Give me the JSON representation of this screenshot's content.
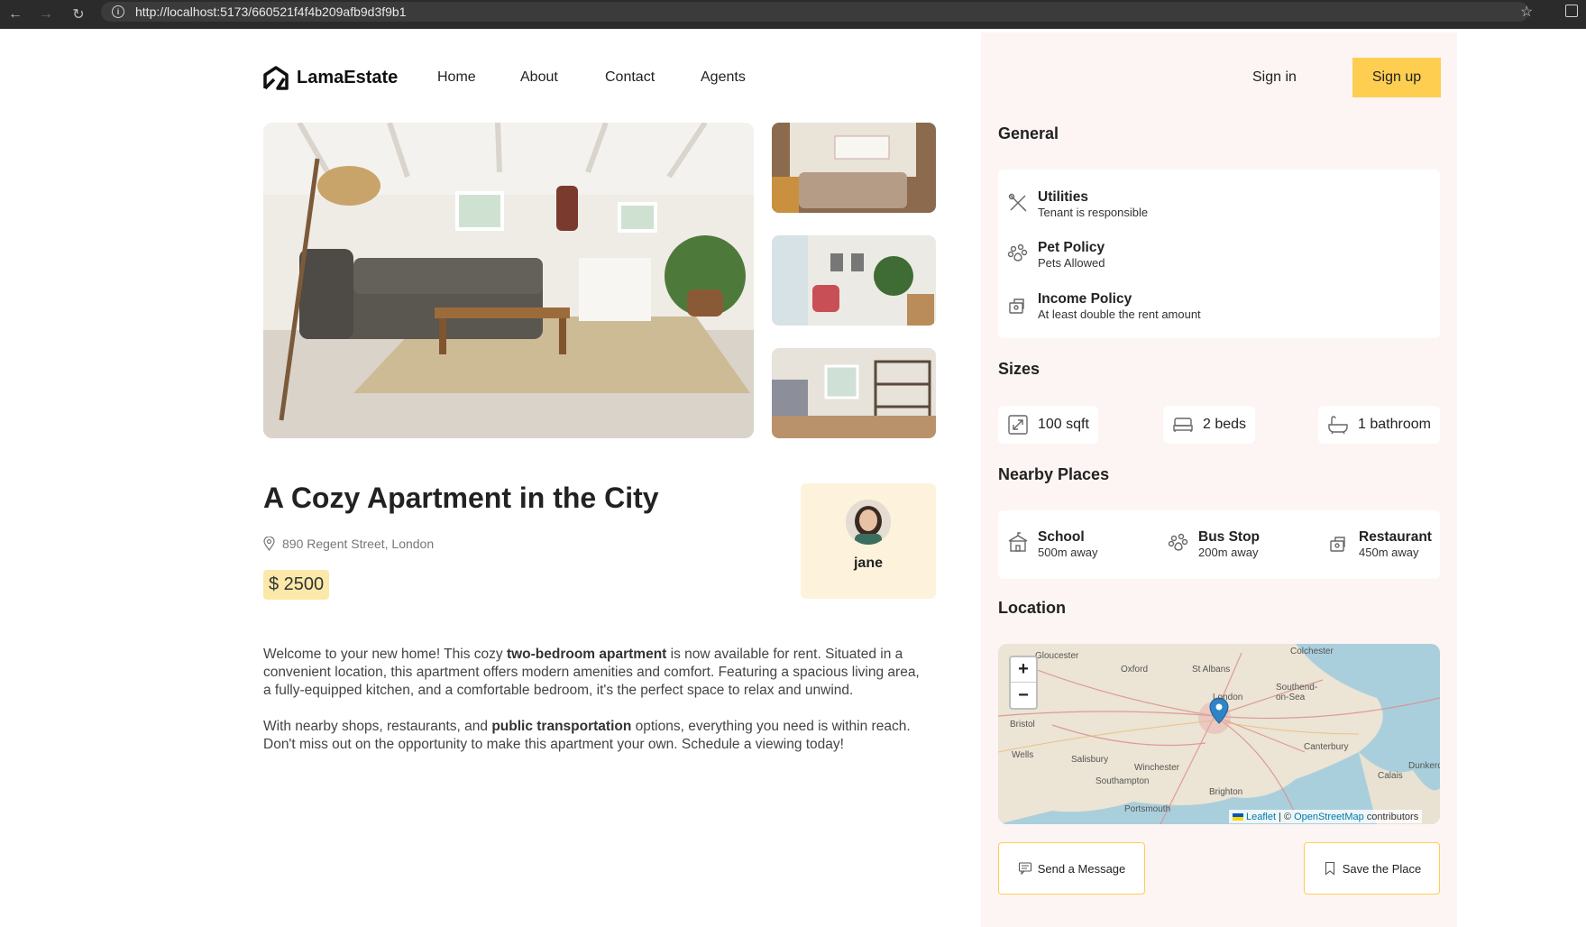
{
  "browser": {
    "url": "http://localhost:5173/660521f4f4b209afb9d3f9b1"
  },
  "navbar": {
    "brand": "LamaEstate",
    "links": [
      "Home",
      "About",
      "Contact",
      "Agents"
    ],
    "signin": "Sign in",
    "signup": "Sign up"
  },
  "listing": {
    "title": "A Cozy Apartment in the City",
    "address": "890 Regent Street, London",
    "price": "$ 2500",
    "user": "jane",
    "description_p1": {
      "t1": "Welcome to your new home! This cozy ",
      "b1": "two-bedroom apartment",
      "t2": " is now available for rent. Situated in a convenient location, this apartment offers modern amenities and comfort. Featuring a spacious living area, a fully-equipped kitchen, and a comfortable bedroom, it's the perfect space to relax and unwind."
    },
    "description_p2": {
      "t1": "With nearby shops, restaurants, and ",
      "b1": "public transportation",
      "t2": " options, everything you need is within reach. Don't miss out on the opportunity to make this apartment your own. Schedule a viewing today!"
    }
  },
  "general": {
    "title": "General",
    "items": [
      {
        "title": "Utilities",
        "sub": "Tenant is responsible",
        "icon": "utility-icon"
      },
      {
        "title": "Pet Policy",
        "sub": "Pets Allowed",
        "icon": "pet-icon"
      },
      {
        "title": "Income Policy",
        "sub": "At least double the rent amount",
        "icon": "fee-icon"
      }
    ]
  },
  "sizes": {
    "title": "Sizes",
    "items": [
      {
        "label": "100 sqft",
        "icon": "size-icon"
      },
      {
        "label": "2 beds",
        "icon": "bed-icon"
      },
      {
        "label": "1 bathroom",
        "icon": "bath-icon"
      }
    ]
  },
  "nearby": {
    "title": "Nearby Places",
    "items": [
      {
        "title": "School",
        "sub": "500m away",
        "icon": "school-icon"
      },
      {
        "title": "Bus Stop",
        "sub": "200m away",
        "icon": "bus-icon"
      },
      {
        "title": "Restaurant",
        "sub": "450m away",
        "icon": "restaurant-icon"
      }
    ]
  },
  "location": {
    "title": "Location",
    "zoom_in": "+",
    "zoom_out": "−",
    "attr_leaflet": "Leaflet",
    "attr_sep": "| ©",
    "attr_osm": "OpenStreetMap",
    "attr_contrib": "contributors",
    "labels": [
      "Gloucester",
      "Oxford",
      "St Albans",
      "Colchester",
      "London",
      "Southend-on-Sea",
      "Bristol",
      "Wells",
      "Salisbury",
      "Winchester",
      "Southampton",
      "Canterbury",
      "Brighton",
      "Portsmouth",
      "Calais",
      "Dunkerque"
    ]
  },
  "actions": {
    "send_message": "Send a Message",
    "save_place": "Save the Place"
  },
  "colors": {
    "accent": "#fece51",
    "panel_bg": "#fcf5f3",
    "price_bg": "#fce9a9"
  }
}
